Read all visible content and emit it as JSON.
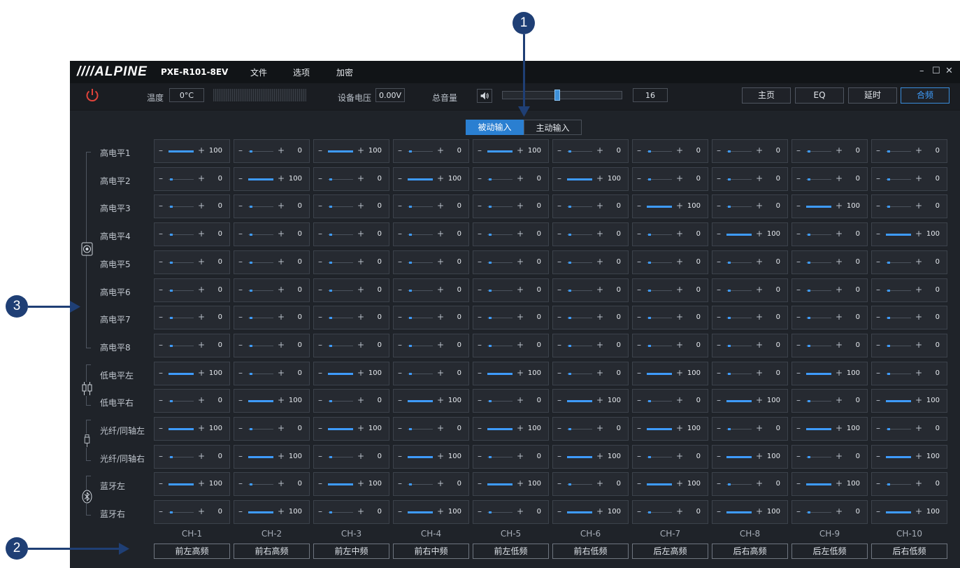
{
  "title": {
    "logo": "////ALPINE",
    "model": "PXE-R101-8EV"
  },
  "menu": [
    "文件",
    "选项",
    "加密"
  ],
  "window_controls": {
    "min": "–",
    "max": "☐",
    "close": "✕"
  },
  "toolbar": {
    "temp_label": "温度",
    "temp_value": "0°C",
    "voltage_label": "设备电压",
    "voltage_value": "0.00V",
    "volume_label": "总音量",
    "volume_value": "16",
    "volume_level": 0.45
  },
  "nav": [
    "主页",
    "EQ",
    "延时",
    "合频"
  ],
  "nav_active": 3,
  "modes": [
    "被动输入",
    "主动输入"
  ],
  "mode_active": 0,
  "rows": [
    "高电平1",
    "高电平2",
    "高电平3",
    "高电平4",
    "高电平5",
    "高电平6",
    "高电平7",
    "高电平8",
    "低电平左",
    "低电平右",
    "光纤/同轴左",
    "光纤/同轴右",
    "蓝牙左",
    "蓝牙右"
  ],
  "matrix": [
    [
      100,
      0,
      100,
      0,
      100,
      0,
      0,
      0,
      0,
      0
    ],
    [
      0,
      100,
      0,
      100,
      0,
      100,
      0,
      0,
      0,
      0
    ],
    [
      0,
      0,
      0,
      0,
      0,
      0,
      100,
      0,
      100,
      0
    ],
    [
      0,
      0,
      0,
      0,
      0,
      0,
      0,
      100,
      0,
      100
    ],
    [
      0,
      0,
      0,
      0,
      0,
      0,
      0,
      0,
      0,
      0
    ],
    [
      0,
      0,
      0,
      0,
      0,
      0,
      0,
      0,
      0,
      0
    ],
    [
      0,
      0,
      0,
      0,
      0,
      0,
      0,
      0,
      0,
      0
    ],
    [
      0,
      0,
      0,
      0,
      0,
      0,
      0,
      0,
      0,
      0
    ],
    [
      100,
      0,
      100,
      0,
      100,
      0,
      100,
      0,
      100,
      0
    ],
    [
      0,
      100,
      0,
      100,
      0,
      100,
      0,
      100,
      0,
      100
    ],
    [
      100,
      0,
      100,
      0,
      100,
      0,
      100,
      0,
      100,
      0
    ],
    [
      0,
      100,
      0,
      100,
      0,
      100,
      0,
      100,
      0,
      100
    ],
    [
      100,
      0,
      100,
      0,
      100,
      0,
      100,
      0,
      100,
      0
    ],
    [
      0,
      100,
      0,
      100,
      0,
      100,
      0,
      100,
      0,
      100
    ]
  ],
  "channels": [
    "CH-1",
    "CH-2",
    "CH-3",
    "CH-4",
    "CH-5",
    "CH-6",
    "CH-7",
    "CH-8",
    "CH-9",
    "CH-10"
  ],
  "channel_labels": [
    "前左高频",
    "前右高频",
    "前左中频",
    "前右中频",
    "前左低频",
    "前右低频",
    "后左高频",
    "后右高频",
    "后左低频",
    "后右低频"
  ],
  "cell_minus": "–",
  "cell_plus": "+",
  "callouts": [
    "1",
    "2",
    "3"
  ],
  "colors": {
    "accent": "#3e9bff",
    "callout": "#1f3f75",
    "power": "#e2443b"
  }
}
